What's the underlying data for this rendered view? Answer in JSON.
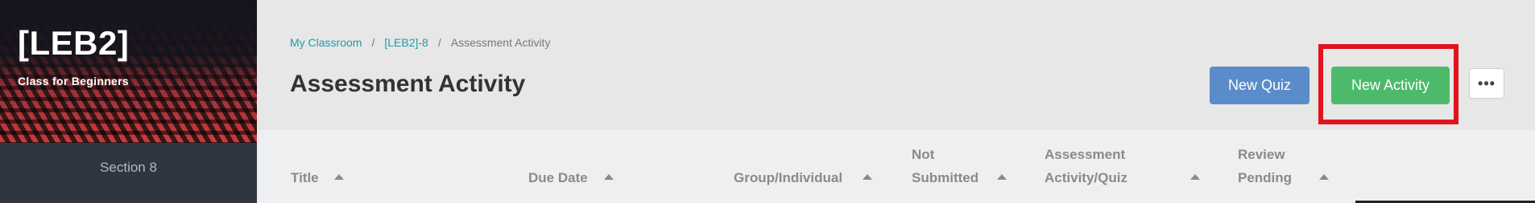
{
  "sidebar": {
    "class_title": "[LEB2]",
    "class_subtitle": "Class for Beginners",
    "section_label": "Section 8"
  },
  "breadcrumb": {
    "items": [
      "My Classroom",
      "[LEB2]-8"
    ],
    "separator": "/",
    "current": "Assessment Activity"
  },
  "header": {
    "page_title": "Assessment Activity",
    "new_quiz_label": "New Quiz",
    "new_activity_label": "New Activity",
    "more_label": "•••"
  },
  "table": {
    "columns": [
      {
        "label_lines": [
          "Title"
        ],
        "icon": "sort-up-icon"
      },
      {
        "label_lines": [
          "Due Date"
        ],
        "icon": "sort-up-icon"
      },
      {
        "label_lines": [
          "Group/Individual"
        ],
        "icon": "sort-up-icon"
      },
      {
        "label_lines": [
          "Not",
          "Submitted"
        ],
        "icon": "sort-up-icon"
      },
      {
        "label_lines": [
          "Assessment",
          "Activity/Quiz"
        ],
        "icon": "sort-up-icon"
      },
      {
        "label_lines": [
          "Review",
          "Pending"
        ],
        "icon": "sort-up-icon"
      }
    ]
  },
  "colors": {
    "accent_link": "#1f9aa8",
    "quiz_button": "#5a8cc9",
    "activity_button": "#4cba6a",
    "highlight": "#e0141e"
  }
}
